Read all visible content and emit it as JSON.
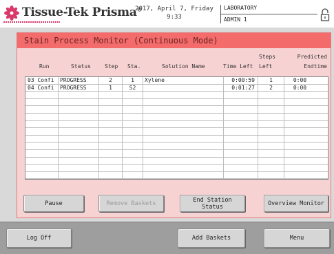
{
  "header": {
    "logo_text": "Tissue-Tek Prisma",
    "logo_reg": "®",
    "date_line": "2017, April 7, Friday",
    "time_line": "9:33",
    "location": "LABORATORY",
    "user": "ADMIN 1"
  },
  "panel": {
    "title": "Stain Process Monitor (Continuous Mode)",
    "columns": {
      "run": "Run",
      "status": "Status",
      "step": "Step",
      "sta": "Sta.",
      "solution": "Solution Name",
      "time_left": "Time Left",
      "steps_left_1": "Steps",
      "steps_left_2": "Left",
      "predicted_1": "Predicted",
      "predicted_2": "Endtime"
    },
    "rows": [
      {
        "run": "03 Confi",
        "status": "PROGRESS",
        "step": "2",
        "sta": "1",
        "solution": "Xylene",
        "time_left": "0:00:59",
        "steps_left": "1",
        "endtime": "0:00"
      },
      {
        "run": "04 Confi",
        "status": "PROGRESS",
        "step": "1",
        "sta": "S2",
        "solution": "",
        "time_left": "0:01:27",
        "steps_left": "2",
        "endtime": "0:00"
      }
    ],
    "buttons": {
      "pause": "Pause",
      "remove": "Remove Baskets",
      "end_station_1": "End Station",
      "end_station_2": "Status",
      "overview": "Overview Monitor"
    }
  },
  "bottom": {
    "logoff": "Log Off",
    "add_baskets": "Add Baskets",
    "menu": "Menu"
  },
  "colors": {
    "panel_title_bg": "#f36b6b",
    "panel_bg": "#f7d2d2",
    "logo_flower": "#d9386a"
  },
  "icons": {
    "logo": "flower-logo-icon",
    "lock": "padlock-icon"
  }
}
